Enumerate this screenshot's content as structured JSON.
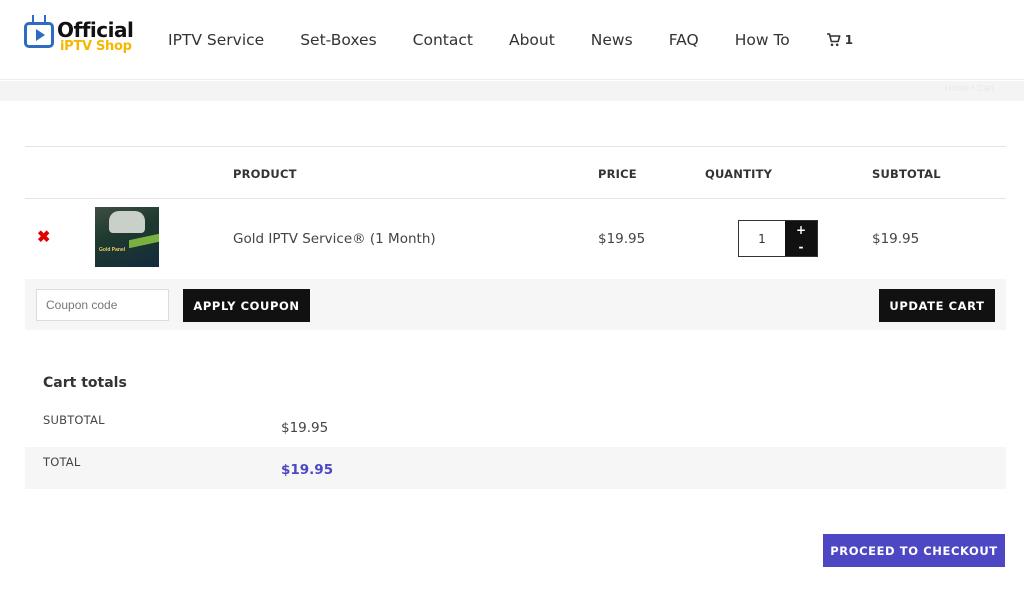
{
  "header": {
    "logo": {
      "line1": "Official",
      "line2": "iPTV Shop"
    },
    "nav": [
      {
        "label": "IPTV Service"
      },
      {
        "label": "Set-Boxes"
      },
      {
        "label": "Contact"
      },
      {
        "label": "About"
      },
      {
        "label": "News"
      },
      {
        "label": "FAQ"
      },
      {
        "label": "How To"
      }
    ],
    "cart_count": "1",
    "cart_icon": "cart-icon"
  },
  "breadcrumb": {
    "text": "Home • Cart"
  },
  "cart": {
    "columns": {
      "product": "PRODUCT",
      "price": "PRICE",
      "quantity": "QUANTITY",
      "subtotal": "SUBTOTAL"
    },
    "items": [
      {
        "name": "Gold IPTV Service® (1 Month)",
        "price": "$19.95",
        "quantity": "1",
        "subtotal": "$19.95",
        "thumb_label": "Gold Panel"
      }
    ],
    "qty_plus": "+",
    "qty_minus": "-",
    "remove_icon": "close-icon",
    "coupon_placeholder": "Coupon code",
    "apply_coupon": "APPLY COUPON",
    "update_cart": "UPDATE CART"
  },
  "totals": {
    "title": "Cart totals",
    "subtotal_label": "SUBTOTAL",
    "subtotal_value": "$19.95",
    "total_label": "TOTAL",
    "total_value": "$19.95"
  },
  "checkout_label": "PROCEED TO CHECKOUT",
  "colors": {
    "accent": "#4d47c4",
    "remove": "#e00000",
    "logo_blue": "#2d6cc0",
    "logo_yellow": "#f5b800"
  }
}
